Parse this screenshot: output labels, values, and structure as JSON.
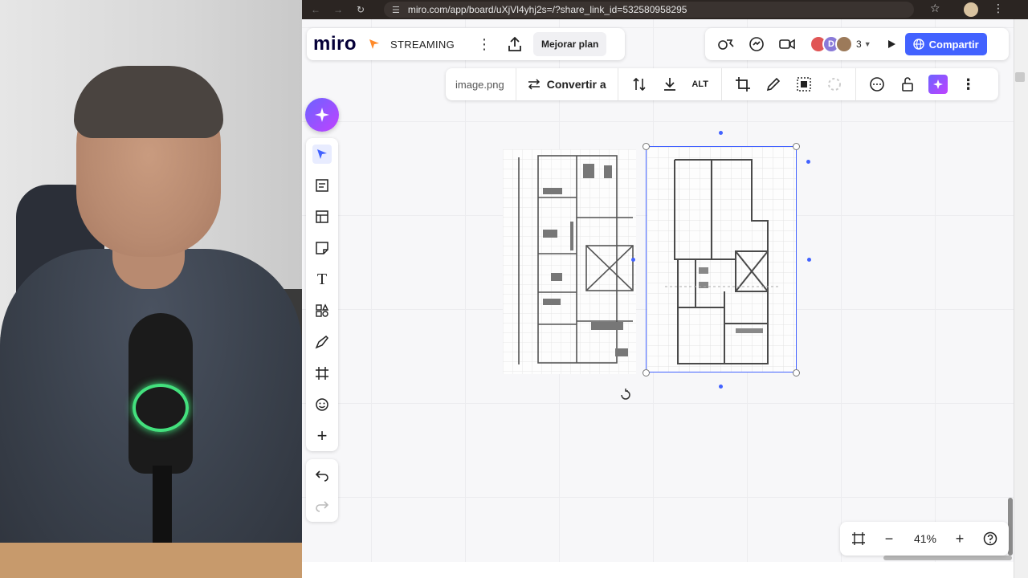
{
  "browser": {
    "url": "miro.com/app/board/uXjVl4yhj2s=/?share_link_id=532580958295"
  },
  "header": {
    "logo": "miro",
    "board_name": "STREAMING",
    "upgrade_label": "Mejorar plan",
    "collaborator_initial": "D",
    "collaborator_count": "3",
    "share_label": "Compartir"
  },
  "context_toolbar": {
    "file_name": "image.png",
    "convert_label": "Convertir a",
    "alt_label": "ALT"
  },
  "zoom": {
    "value": "41%"
  },
  "colors": {
    "accent": "#4262ff",
    "ai_gradient_start": "#6c63ff",
    "ai_gradient_end": "#c042ff"
  },
  "icons": {
    "left_toolbar": [
      "select-icon",
      "templates-icon",
      "frame-layout-icon",
      "sticky-note-icon",
      "text-icon",
      "shapes-icon",
      "pen-icon",
      "frame-icon",
      "emoji-icon",
      "add-icon"
    ],
    "undo_redo": [
      "undo-icon",
      "redo-icon"
    ]
  }
}
